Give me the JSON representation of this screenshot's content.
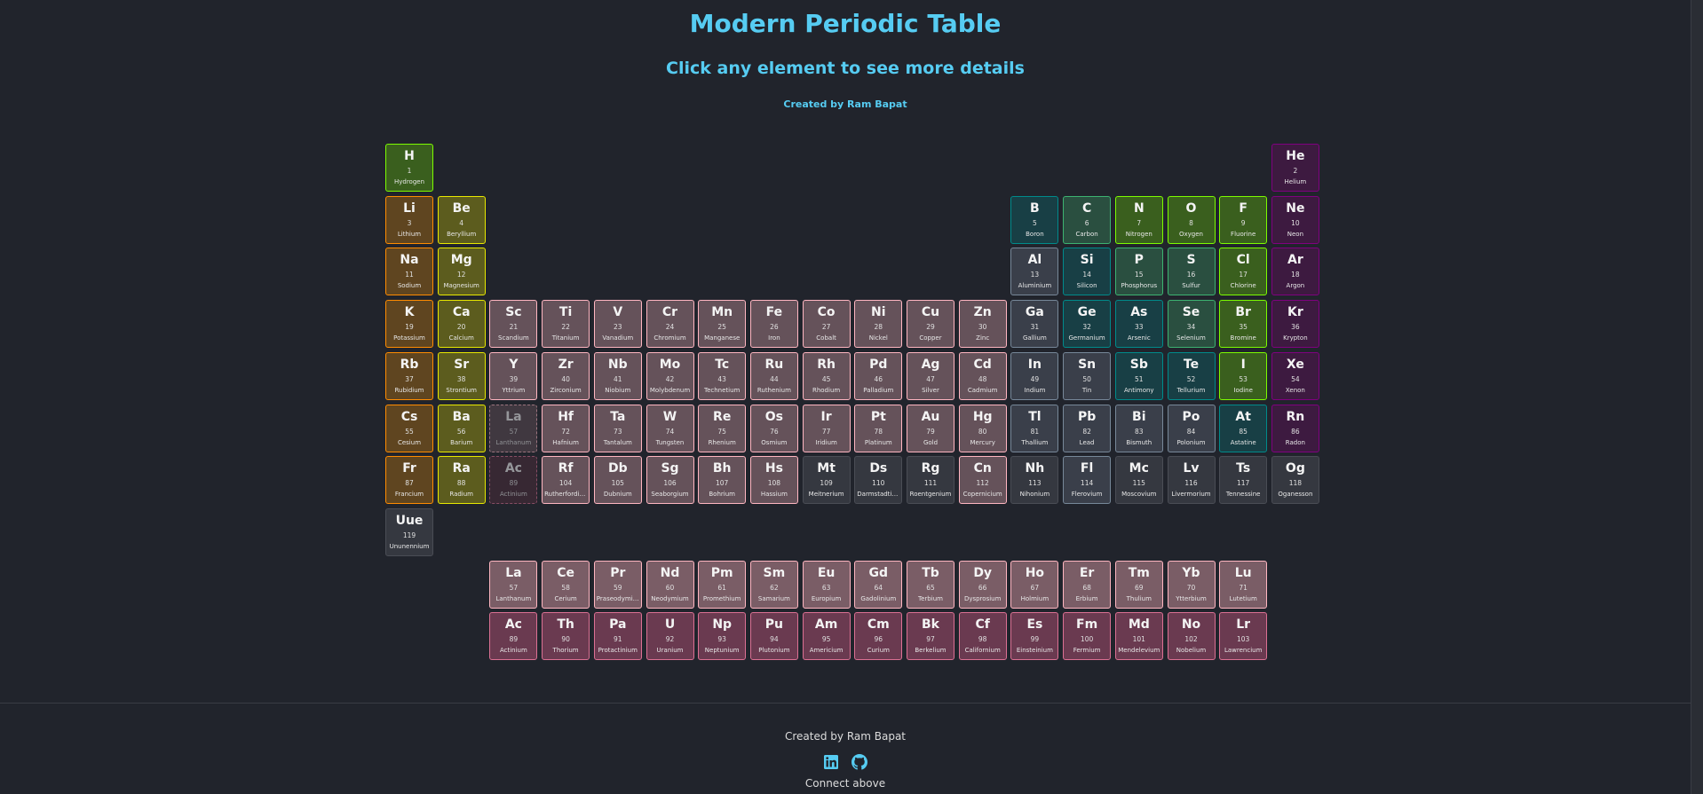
{
  "header": {
    "title": "Modern Periodic Table",
    "subtitle": "Click any element to see more details",
    "credit": "Created by Ram Bapat"
  },
  "footer": {
    "credit": "Created by Ram Bapat",
    "connect": "Connect above",
    "icons": [
      "linkedin-icon",
      "github-icon"
    ]
  },
  "colors": {
    "accent": "#56ccf2",
    "alkali": [
      "#5f4520",
      "#ff8c00"
    ],
    "alkaline": [
      "#5c5c1e",
      "#e8e800"
    ],
    "reactive": [
      "#3a5f1e",
      "#7cfc00"
    ],
    "polyatomic": [
      "#2a4f40",
      "#3cb371"
    ],
    "metalloid": [
      "#183f45",
      "#008b8b"
    ],
    "post": [
      "#3a3f4a",
      "#778899"
    ],
    "noble": [
      "#3d1a40",
      "#800080"
    ],
    "transition": [
      "#65525a",
      "#ffb6c1"
    ],
    "unknown": [
      "#353840",
      "#4a4d55"
    ],
    "lanthanide": [
      "#7a5d66",
      "#ffb6c1"
    ],
    "actinide": [
      "#6a3a50",
      "#db7093"
    ]
  },
  "placeholders": [
    {
      "s": "La",
      "n": 57,
      "name": "Lanthanum",
      "cat": "lanthanide",
      "p": 6,
      "g": 3
    },
    {
      "s": "Ac",
      "n": 89,
      "name": "Actinium",
      "cat": "actinide",
      "p": 7,
      "g": 3
    }
  ],
  "elements": [
    {
      "n": 1,
      "s": "H",
      "name": "Hydrogen",
      "cat": "reactive",
      "p": 1,
      "g": 1
    },
    {
      "n": 2,
      "s": "He",
      "name": "Helium",
      "cat": "noble",
      "p": 1,
      "g": 18
    },
    {
      "n": 3,
      "s": "Li",
      "name": "Lithium",
      "cat": "alkali",
      "p": 2,
      "g": 1
    },
    {
      "n": 4,
      "s": "Be",
      "name": "Beryllium",
      "cat": "alkaline",
      "p": 2,
      "g": 2
    },
    {
      "n": 5,
      "s": "B",
      "name": "Boron",
      "cat": "metalloid",
      "p": 2,
      "g": 13
    },
    {
      "n": 6,
      "s": "C",
      "name": "Carbon",
      "cat": "polyatomic",
      "p": 2,
      "g": 14
    },
    {
      "n": 7,
      "s": "N",
      "name": "Nitrogen",
      "cat": "reactive",
      "p": 2,
      "g": 15
    },
    {
      "n": 8,
      "s": "O",
      "name": "Oxygen",
      "cat": "reactive",
      "p": 2,
      "g": 16
    },
    {
      "n": 9,
      "s": "F",
      "name": "Fluorine",
      "cat": "reactive",
      "p": 2,
      "g": 17
    },
    {
      "n": 10,
      "s": "Ne",
      "name": "Neon",
      "cat": "noble",
      "p": 2,
      "g": 18
    },
    {
      "n": 11,
      "s": "Na",
      "name": "Sodium",
      "cat": "alkali",
      "p": 3,
      "g": 1
    },
    {
      "n": 12,
      "s": "Mg",
      "name": "Magnesium",
      "cat": "alkaline",
      "p": 3,
      "g": 2
    },
    {
      "n": 13,
      "s": "Al",
      "name": "Aluminium",
      "cat": "post",
      "p": 3,
      "g": 13
    },
    {
      "n": 14,
      "s": "Si",
      "name": "Silicon",
      "cat": "metalloid",
      "p": 3,
      "g": 14
    },
    {
      "n": 15,
      "s": "P",
      "name": "Phosphorus",
      "cat": "polyatomic",
      "p": 3,
      "g": 15
    },
    {
      "n": 16,
      "s": "S",
      "name": "Sulfur",
      "cat": "polyatomic",
      "p": 3,
      "g": 16
    },
    {
      "n": 17,
      "s": "Cl",
      "name": "Chlorine",
      "cat": "reactive",
      "p": 3,
      "g": 17
    },
    {
      "n": 18,
      "s": "Ar",
      "name": "Argon",
      "cat": "noble",
      "p": 3,
      "g": 18
    },
    {
      "n": 19,
      "s": "K",
      "name": "Potassium",
      "cat": "alkali",
      "p": 4,
      "g": 1
    },
    {
      "n": 20,
      "s": "Ca",
      "name": "Calcium",
      "cat": "alkaline",
      "p": 4,
      "g": 2
    },
    {
      "n": 21,
      "s": "Sc",
      "name": "Scandium",
      "cat": "transition",
      "p": 4,
      "g": 3
    },
    {
      "n": 22,
      "s": "Ti",
      "name": "Titanium",
      "cat": "transition",
      "p": 4,
      "g": 4
    },
    {
      "n": 23,
      "s": "V",
      "name": "Vanadium",
      "cat": "transition",
      "p": 4,
      "g": 5
    },
    {
      "n": 24,
      "s": "Cr",
      "name": "Chromium",
      "cat": "transition",
      "p": 4,
      "g": 6
    },
    {
      "n": 25,
      "s": "Mn",
      "name": "Manganese",
      "cat": "transition",
      "p": 4,
      "g": 7
    },
    {
      "n": 26,
      "s": "Fe",
      "name": "Iron",
      "cat": "transition",
      "p": 4,
      "g": 8
    },
    {
      "n": 27,
      "s": "Co",
      "name": "Cobalt",
      "cat": "transition",
      "p": 4,
      "g": 9
    },
    {
      "n": 28,
      "s": "Ni",
      "name": "Nickel",
      "cat": "transition",
      "p": 4,
      "g": 10
    },
    {
      "n": 29,
      "s": "Cu",
      "name": "Copper",
      "cat": "transition",
      "p": 4,
      "g": 11
    },
    {
      "n": 30,
      "s": "Zn",
      "name": "Zinc",
      "cat": "transition",
      "p": 4,
      "g": 12
    },
    {
      "n": 31,
      "s": "Ga",
      "name": "Gallium",
      "cat": "post",
      "p": 4,
      "g": 13
    },
    {
      "n": 32,
      "s": "Ge",
      "name": "Germanium",
      "cat": "metalloid",
      "p": 4,
      "g": 14
    },
    {
      "n": 33,
      "s": "As",
      "name": "Arsenic",
      "cat": "metalloid",
      "p": 4,
      "g": 15
    },
    {
      "n": 34,
      "s": "Se",
      "name": "Selenium",
      "cat": "polyatomic",
      "p": 4,
      "g": 16
    },
    {
      "n": 35,
      "s": "Br",
      "name": "Bromine",
      "cat": "reactive",
      "p": 4,
      "g": 17
    },
    {
      "n": 36,
      "s": "Kr",
      "name": "Krypton",
      "cat": "noble",
      "p": 4,
      "g": 18
    },
    {
      "n": 37,
      "s": "Rb",
      "name": "Rubidium",
      "cat": "alkali",
      "p": 5,
      "g": 1
    },
    {
      "n": 38,
      "s": "Sr",
      "name": "Strontium",
      "cat": "alkaline",
      "p": 5,
      "g": 2
    },
    {
      "n": 39,
      "s": "Y",
      "name": "Yttrium",
      "cat": "transition",
      "p": 5,
      "g": 3
    },
    {
      "n": 40,
      "s": "Zr",
      "name": "Zirconium",
      "cat": "transition",
      "p": 5,
      "g": 4
    },
    {
      "n": 41,
      "s": "Nb",
      "name": "Niobium",
      "cat": "transition",
      "p": 5,
      "g": 5
    },
    {
      "n": 42,
      "s": "Mo",
      "name": "Molybdenum",
      "cat": "transition",
      "p": 5,
      "g": 6
    },
    {
      "n": 43,
      "s": "Tc",
      "name": "Technetium",
      "cat": "transition",
      "p": 5,
      "g": 7
    },
    {
      "n": 44,
      "s": "Ru",
      "name": "Ruthenium",
      "cat": "transition",
      "p": 5,
      "g": 8
    },
    {
      "n": 45,
      "s": "Rh",
      "name": "Rhodium",
      "cat": "transition",
      "p": 5,
      "g": 9
    },
    {
      "n": 46,
      "s": "Pd",
      "name": "Palladium",
      "cat": "transition",
      "p": 5,
      "g": 10
    },
    {
      "n": 47,
      "s": "Ag",
      "name": "Silver",
      "cat": "transition",
      "p": 5,
      "g": 11
    },
    {
      "n": 48,
      "s": "Cd",
      "name": "Cadmium",
      "cat": "transition",
      "p": 5,
      "g": 12
    },
    {
      "n": 49,
      "s": "In",
      "name": "Indium",
      "cat": "post",
      "p": 5,
      "g": 13
    },
    {
      "n": 50,
      "s": "Sn",
      "name": "Tin",
      "cat": "post",
      "p": 5,
      "g": 14
    },
    {
      "n": 51,
      "s": "Sb",
      "name": "Antimony",
      "cat": "metalloid",
      "p": 5,
      "g": 15
    },
    {
      "n": 52,
      "s": "Te",
      "name": "Tellurium",
      "cat": "metalloid",
      "p": 5,
      "g": 16
    },
    {
      "n": 53,
      "s": "I",
      "name": "Iodine",
      "cat": "reactive",
      "p": 5,
      "g": 17
    },
    {
      "n": 54,
      "s": "Xe",
      "name": "Xenon",
      "cat": "noble",
      "p": 5,
      "g": 18
    },
    {
      "n": 55,
      "s": "Cs",
      "name": "Cesium",
      "cat": "alkali",
      "p": 6,
      "g": 1
    },
    {
      "n": 56,
      "s": "Ba",
      "name": "Barium",
      "cat": "alkaline",
      "p": 6,
      "g": 2
    },
    {
      "n": 72,
      "s": "Hf",
      "name": "Hafnium",
      "cat": "transition",
      "p": 6,
      "g": 4
    },
    {
      "n": 73,
      "s": "Ta",
      "name": "Tantalum",
      "cat": "transition",
      "p": 6,
      "g": 5
    },
    {
      "n": 74,
      "s": "W",
      "name": "Tungsten",
      "cat": "transition",
      "p": 6,
      "g": 6
    },
    {
      "n": 75,
      "s": "Re",
      "name": "Rhenium",
      "cat": "transition",
      "p": 6,
      "g": 7
    },
    {
      "n": 76,
      "s": "Os",
      "name": "Osmium",
      "cat": "transition",
      "p": 6,
      "g": 8
    },
    {
      "n": 77,
      "s": "Ir",
      "name": "Iridium",
      "cat": "transition",
      "p": 6,
      "g": 9
    },
    {
      "n": 78,
      "s": "Pt",
      "name": "Platinum",
      "cat": "transition",
      "p": 6,
      "g": 10
    },
    {
      "n": 79,
      "s": "Au",
      "name": "Gold",
      "cat": "transition",
      "p": 6,
      "g": 11
    },
    {
      "n": 80,
      "s": "Hg",
      "name": "Mercury",
      "cat": "transition",
      "p": 6,
      "g": 12
    },
    {
      "n": 81,
      "s": "Tl",
      "name": "Thallium",
      "cat": "post",
      "p": 6,
      "g": 13
    },
    {
      "n": 82,
      "s": "Pb",
      "name": "Lead",
      "cat": "post",
      "p": 6,
      "g": 14
    },
    {
      "n": 83,
      "s": "Bi",
      "name": "Bismuth",
      "cat": "post",
      "p": 6,
      "g": 15
    },
    {
      "n": 84,
      "s": "Po",
      "name": "Polonium",
      "cat": "post",
      "p": 6,
      "g": 16
    },
    {
      "n": 85,
      "s": "At",
      "name": "Astatine",
      "cat": "metalloid",
      "p": 6,
      "g": 17
    },
    {
      "n": 86,
      "s": "Rn",
      "name": "Radon",
      "cat": "noble",
      "p": 6,
      "g": 18
    },
    {
      "n": 87,
      "s": "Fr",
      "name": "Francium",
      "cat": "alkali",
      "p": 7,
      "g": 1
    },
    {
      "n": 88,
      "s": "Ra",
      "name": "Radium",
      "cat": "alkaline",
      "p": 7,
      "g": 2
    },
    {
      "n": 104,
      "s": "Rf",
      "name": "Rutherfordium",
      "cat": "transition",
      "p": 7,
      "g": 4
    },
    {
      "n": 105,
      "s": "Db",
      "name": "Dubnium",
      "cat": "transition",
      "p": 7,
      "g": 5
    },
    {
      "n": 106,
      "s": "Sg",
      "name": "Seaborgium",
      "cat": "transition",
      "p": 7,
      "g": 6
    },
    {
      "n": 107,
      "s": "Bh",
      "name": "Bohrium",
      "cat": "transition",
      "p": 7,
      "g": 7
    },
    {
      "n": 108,
      "s": "Hs",
      "name": "Hassium",
      "cat": "transition",
      "p": 7,
      "g": 8
    },
    {
      "n": 109,
      "s": "Mt",
      "name": "Meitnerium",
      "cat": "unknown",
      "p": 7,
      "g": 9
    },
    {
      "n": 110,
      "s": "Ds",
      "name": "Darmstadtium",
      "cat": "unknown",
      "p": 7,
      "g": 10
    },
    {
      "n": 111,
      "s": "Rg",
      "name": "Roentgenium",
      "cat": "unknown",
      "p": 7,
      "g": 11
    },
    {
      "n": 112,
      "s": "Cn",
      "name": "Copernicium",
      "cat": "transition",
      "p": 7,
      "g": 12
    },
    {
      "n": 113,
      "s": "Nh",
      "name": "Nihonium",
      "cat": "unknown",
      "p": 7,
      "g": 13
    },
    {
      "n": 114,
      "s": "Fl",
      "name": "Flerovium",
      "cat": "post",
      "p": 7,
      "g": 14
    },
    {
      "n": 115,
      "s": "Mc",
      "name": "Moscovium",
      "cat": "unknown",
      "p": 7,
      "g": 15
    },
    {
      "n": 116,
      "s": "Lv",
      "name": "Livermorium",
      "cat": "unknown",
      "p": 7,
      "g": 16
    },
    {
      "n": 117,
      "s": "Ts",
      "name": "Tennessine",
      "cat": "unknown",
      "p": 7,
      "g": 17
    },
    {
      "n": 118,
      "s": "Og",
      "name": "Oganesson",
      "cat": "unknown",
      "p": 7,
      "g": 18
    },
    {
      "n": 119,
      "s": "Uue",
      "name": "Ununennium",
      "cat": "unknown",
      "p": 8,
      "g": 1
    },
    {
      "n": 57,
      "s": "La",
      "name": "Lanthanum",
      "cat": "lanthanide"
    },
    {
      "n": 58,
      "s": "Ce",
      "name": "Cerium",
      "cat": "lanthanide"
    },
    {
      "n": 59,
      "s": "Pr",
      "name": "Praseodymium",
      "cat": "lanthanide"
    },
    {
      "n": 60,
      "s": "Nd",
      "name": "Neodymium",
      "cat": "lanthanide"
    },
    {
      "n": 61,
      "s": "Pm",
      "name": "Promethium",
      "cat": "lanthanide"
    },
    {
      "n": 62,
      "s": "Sm",
      "name": "Samarium",
      "cat": "lanthanide"
    },
    {
      "n": 63,
      "s": "Eu",
      "name": "Europium",
      "cat": "lanthanide"
    },
    {
      "n": 64,
      "s": "Gd",
      "name": "Gadolinium",
      "cat": "lanthanide"
    },
    {
      "n": 65,
      "s": "Tb",
      "name": "Terbium",
      "cat": "lanthanide"
    },
    {
      "n": 66,
      "s": "Dy",
      "name": "Dysprosium",
      "cat": "lanthanide"
    },
    {
      "n": 67,
      "s": "Ho",
      "name": "Holmium",
      "cat": "lanthanide"
    },
    {
      "n": 68,
      "s": "Er",
      "name": "Erbium",
      "cat": "lanthanide"
    },
    {
      "n": 69,
      "s": "Tm",
      "name": "Thulium",
      "cat": "lanthanide"
    },
    {
      "n": 70,
      "s": "Yb",
      "name": "Ytterbium",
      "cat": "lanthanide"
    },
    {
      "n": 71,
      "s": "Lu",
      "name": "Lutetium",
      "cat": "lanthanide"
    },
    {
      "n": 89,
      "s": "Ac",
      "name": "Actinium",
      "cat": "actinide"
    },
    {
      "n": 90,
      "s": "Th",
      "name": "Thorium",
      "cat": "actinide"
    },
    {
      "n": 91,
      "s": "Pa",
      "name": "Protactinium",
      "cat": "actinide"
    },
    {
      "n": 92,
      "s": "U",
      "name": "Uranium",
      "cat": "actinide"
    },
    {
      "n": 93,
      "s": "Np",
      "name": "Neptunium",
      "cat": "actinide"
    },
    {
      "n": 94,
      "s": "Pu",
      "name": "Plutonium",
      "cat": "actinide"
    },
    {
      "n": 95,
      "s": "Am",
      "name": "Americium",
      "cat": "actinide"
    },
    {
      "n": 96,
      "s": "Cm",
      "name": "Curium",
      "cat": "actinide"
    },
    {
      "n": 97,
      "s": "Bk",
      "name": "Berkelium",
      "cat": "actinide"
    },
    {
      "n": 98,
      "s": "Cf",
      "name": "Californium",
      "cat": "actinide"
    },
    {
      "n": 99,
      "s": "Es",
      "name": "Einsteinium",
      "cat": "actinide"
    },
    {
      "n": 100,
      "s": "Fm",
      "name": "Fermium",
      "cat": "actinide"
    },
    {
      "n": 101,
      "s": "Md",
      "name": "Mendelevium",
      "cat": "actinide"
    },
    {
      "n": 102,
      "s": "No",
      "name": "Nobelium",
      "cat": "actinide"
    },
    {
      "n": 103,
      "s": "Lr",
      "name": "Lawrencium",
      "cat": "actinide"
    }
  ]
}
